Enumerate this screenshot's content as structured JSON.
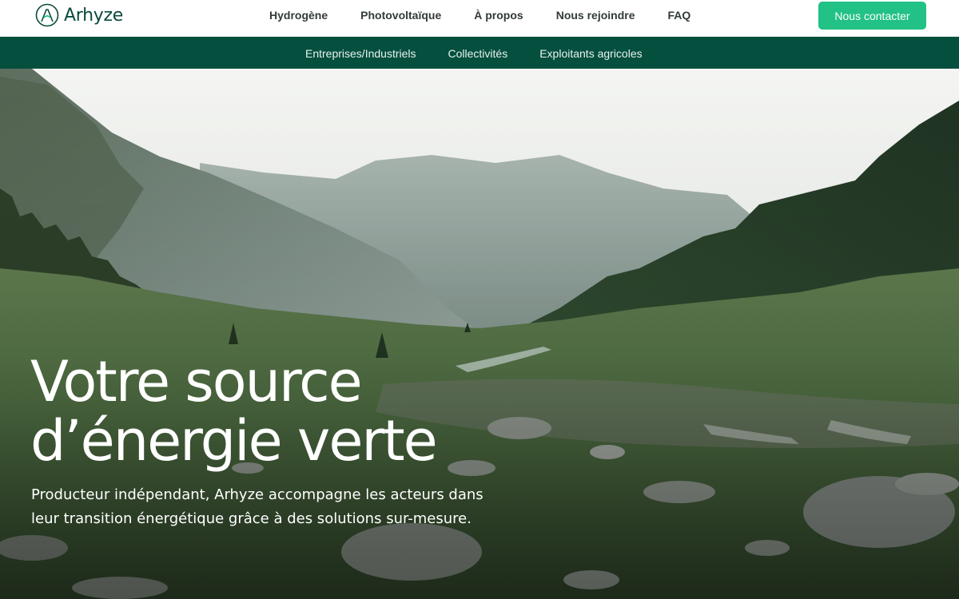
{
  "brand": {
    "name": "Arhyze",
    "logo_icon": "arhyze-logo-icon",
    "color": "#0b4a3c"
  },
  "main_nav": [
    {
      "label": "Hydrogène"
    },
    {
      "label": "Photovoltaïque"
    },
    {
      "label": "À propos"
    },
    {
      "label": "Nous rejoindre"
    },
    {
      "label": "FAQ"
    }
  ],
  "cta": {
    "label": "Nous contacter",
    "color": "#22c185"
  },
  "sub_nav": [
    {
      "label": "Entreprises/Industriels"
    },
    {
      "label": "Collectivités"
    },
    {
      "label": "Exploitants agricoles"
    }
  ],
  "sub_nav_color": "#054f3e",
  "hero": {
    "title_line1": "Votre source",
    "title_line2": "d’énergie verte",
    "subtitle_line1": "Producteur indépendant, Arhyze accompagne les acteurs dans",
    "subtitle_line2": "leur transition énergétique grâce à des solutions sur-mesure."
  }
}
